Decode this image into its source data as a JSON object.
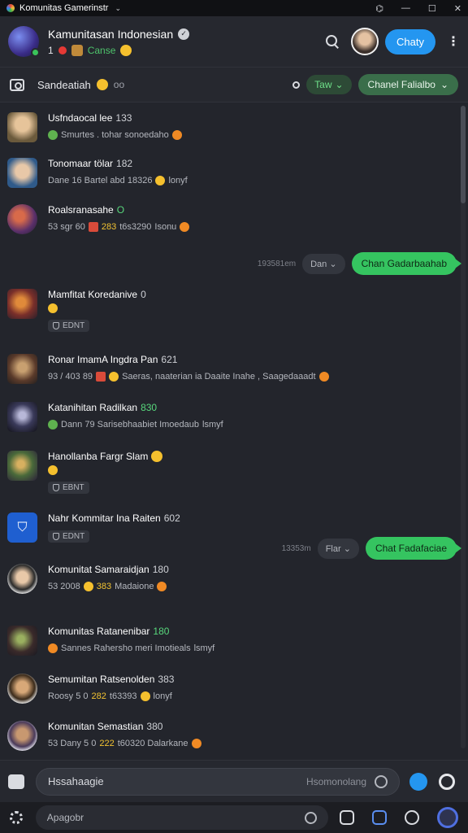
{
  "titlebar": {
    "title": "Komunitas Gamerinstr"
  },
  "header": {
    "title": "Kamunitasan Indonesian",
    "count": "1",
    "status_text": "Canse",
    "cta_label": "Chaty"
  },
  "toolbar": {
    "label": "Sandeatiah",
    "suffix": "oo",
    "filter_label": "Taw",
    "channel_label": "Chanel Falialbo"
  },
  "colors": {
    "accent_blue": "#2496f0",
    "accent_green": "#35c460",
    "background": "#23252c"
  },
  "items": [
    {
      "name": "Usfndaocal lee",
      "badge": "133",
      "meta": "Smurtes . tohar sonoedaho"
    },
    {
      "name": "Tonomaar tölar",
      "badge": "182",
      "meta": "Dane 16 Bartel abd 18326",
      "meta_tail": "lonyf"
    },
    {
      "name": "Roalsranasahe",
      "badge": "O",
      "meta_pre": "53 sgr 60",
      "meta_highlight": "283",
      "meta": "t6s3290",
      "meta_tail": "Isonu"
    },
    {
      "name": "Mamfitat Koredanive",
      "badge": "0",
      "tag": "EDNT"
    },
    {
      "name": "Ronar ImamA Ingdra Pan",
      "badge": "621",
      "meta_pre": "93 / 403 89",
      "meta": "Saeras, naaterian ia Daaite Inahe , Saagedaaadt"
    },
    {
      "name": "Katanihitan Radilkan",
      "badge": "830",
      "meta": "Dann 79 Sarisebhaabiet Imoedaub",
      "meta_tail": "lsmyf"
    },
    {
      "name": "Hanollanba Fargr Slam",
      "tag": "EBNT"
    },
    {
      "name": "Nahr Kommitar Ina Raiten",
      "badge": "602",
      "tag": "EDNT"
    },
    {
      "name": "Komunitat Samaraidjan",
      "badge": "180",
      "meta_pre": "53 2008",
      "meta_highlight": "383",
      "meta": "Madaione"
    },
    {
      "name": "Komunitas Ratanenibar",
      "badge": "180",
      "meta": "Sannes Rahersho meri Imotieals",
      "meta_tail": "lsmyf"
    },
    {
      "name": "Semumitan Ratsenolden",
      "badge": "383",
      "meta_pre": "Roosy 5 0",
      "meta_highlight": "282",
      "meta": "t63393",
      "meta_tail": "lonyf"
    },
    {
      "name": "Komunitan Semastian",
      "badge": "380",
      "meta_pre": "53 Dany 5 0",
      "meta_highlight": "222",
      "meta": "t60320 Dalarkane"
    }
  ],
  "bubbles": [
    {
      "time": "193581em",
      "dropdown": "Dan",
      "text": "Chan Gadarbaahab"
    },
    {
      "time": "13353m",
      "dropdown": "Flar",
      "text": "Chat Fadafaciae"
    }
  ],
  "composer": {
    "placeholder": "Hssahaagie",
    "secondary": "Hsomonolang"
  },
  "bottombar": {
    "placeholder": "Apagobr"
  }
}
